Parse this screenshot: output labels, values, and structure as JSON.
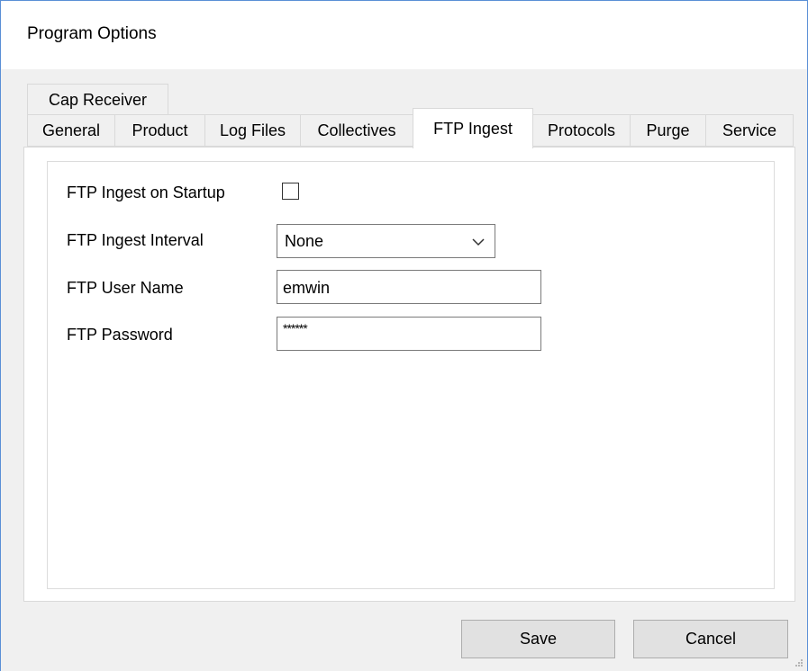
{
  "window": {
    "title": "Program Options"
  },
  "tabs": {
    "row_top": [
      {
        "label": "Cap Receiver"
      }
    ],
    "row_bottom": [
      {
        "label": "General"
      },
      {
        "label": "Product"
      },
      {
        "label": "Log Files"
      },
      {
        "label": "Collectives"
      },
      {
        "label": "FTP Ingest",
        "active": true
      },
      {
        "label": "Protocols"
      },
      {
        "label": "Purge"
      },
      {
        "label": "Service"
      }
    ]
  },
  "ftp_ingest": {
    "startup_label": "FTP Ingest on Startup",
    "startup_checked": false,
    "interval_label": "FTP Ingest Interval",
    "interval_value": "None",
    "username_label": "FTP User Name",
    "username_value": "emwin",
    "password_label": "FTP Password",
    "password_value": "******"
  },
  "buttons": {
    "save": "Save",
    "cancel": "Cancel"
  },
  "icons": {
    "dropdown": "chevron-down-icon",
    "grip": "resize-grip-icon"
  }
}
